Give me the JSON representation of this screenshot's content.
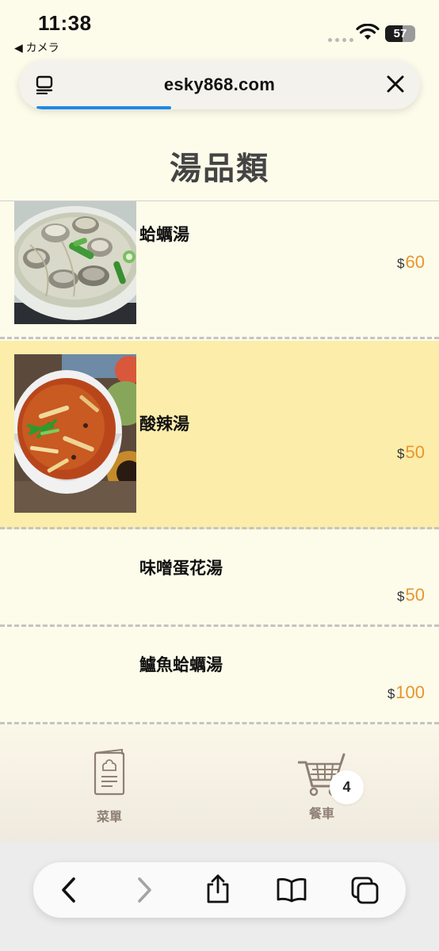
{
  "status": {
    "time": "11:38",
    "back_app": "◀ カメラ",
    "battery": "57"
  },
  "browser": {
    "url": "esky868.com",
    "load_progress": 0.38
  },
  "page": {
    "title": "湯品類"
  },
  "menu": [
    {
      "name": "蛤蠣湯",
      "currency": "$",
      "price": "60",
      "has_image": true,
      "highlighted": false
    },
    {
      "name": "酸辣湯",
      "currency": "$",
      "price": "50",
      "has_image": true,
      "highlighted": true
    },
    {
      "name": "味噌蛋花湯",
      "currency": "$",
      "price": "50",
      "has_image": false,
      "highlighted": false
    },
    {
      "name": "鱸魚蛤蠣湯",
      "currency": "$",
      "price": "100",
      "has_image": false,
      "highlighted": false
    }
  ],
  "bottom_nav": {
    "menu_label": "菜單",
    "cart_label": "餐車",
    "cart_count": "4"
  },
  "colors": {
    "background": "#fdfbea",
    "highlight": "#fcedaa",
    "price": "#e6962e",
    "progress": "#1e88e5"
  }
}
